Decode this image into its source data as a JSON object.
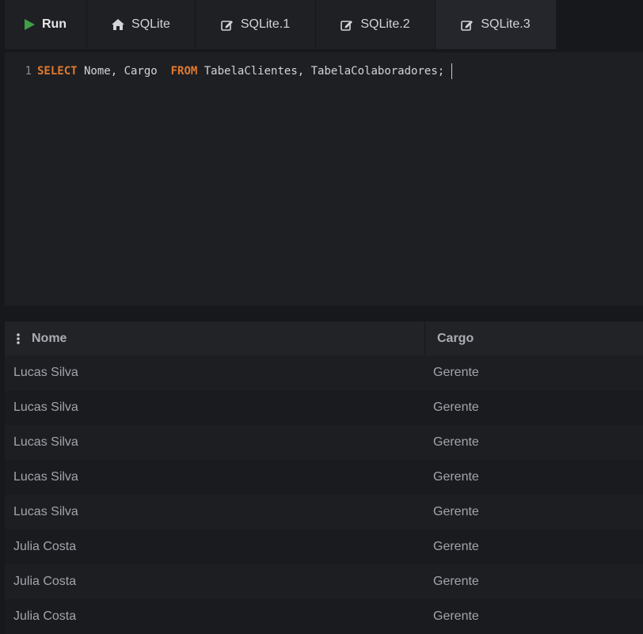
{
  "toolbar": {
    "run_label": "Run",
    "tabs": [
      {
        "label": "SQLite",
        "icon": "home-icon"
      },
      {
        "label": "SQLite.1",
        "icon": "edit-icon"
      },
      {
        "label": "SQLite.2",
        "icon": "edit-icon"
      },
      {
        "label": "SQLite.3",
        "icon": "edit-icon",
        "active": true
      }
    ]
  },
  "editor": {
    "line_number": "1",
    "kw_select": "SELECT",
    "columns_text": " Nome, Cargo  ",
    "kw_from": "FROM",
    "tables_text": " TabelaClientes, TabelaColaboradores;"
  },
  "results": {
    "columns": [
      "Nome",
      "Cargo"
    ],
    "rows": [
      [
        "Lucas Silva",
        "Gerente"
      ],
      [
        "Lucas Silva",
        "Gerente"
      ],
      [
        "Lucas Silva",
        "Gerente"
      ],
      [
        "Lucas Silva",
        "Gerente"
      ],
      [
        "Lucas Silva",
        "Gerente"
      ],
      [
        "Julia Costa",
        "Gerente"
      ],
      [
        "Julia Costa",
        "Gerente"
      ],
      [
        "Julia Costa",
        "Gerente"
      ]
    ]
  },
  "colors": {
    "run_green": "#3fa045",
    "keyword": "#e07a2f",
    "background": "#17181c"
  }
}
